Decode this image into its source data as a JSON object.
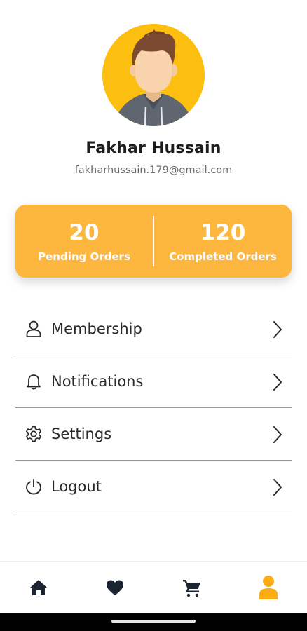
{
  "profile": {
    "name": "Fakhar Hussain",
    "email": "fakharhussain.179@gmail.com"
  },
  "stats": {
    "pending": {
      "value": "20",
      "label": "Pending Orders"
    },
    "completed": {
      "value": "120",
      "label": "Completed Orders"
    }
  },
  "menu": [
    {
      "label": "Membership",
      "icon": "user-outline-icon"
    },
    {
      "label": "Notifications",
      "icon": "bell-icon"
    },
    {
      "label": "Settings",
      "icon": "gear-icon"
    },
    {
      "label": "Logout",
      "icon": "power-icon"
    }
  ],
  "bottom_nav": [
    {
      "icon": "home-icon",
      "active": false
    },
    {
      "icon": "heart-icon",
      "active": false
    },
    {
      "icon": "cart-icon",
      "active": false
    },
    {
      "icon": "profile-icon",
      "active": true
    }
  ],
  "colors": {
    "accent": "#fdb63e",
    "avatar_bg": "#fcbf0f",
    "active_nav": "#fbab14",
    "nav_icon": "#1c2331"
  }
}
